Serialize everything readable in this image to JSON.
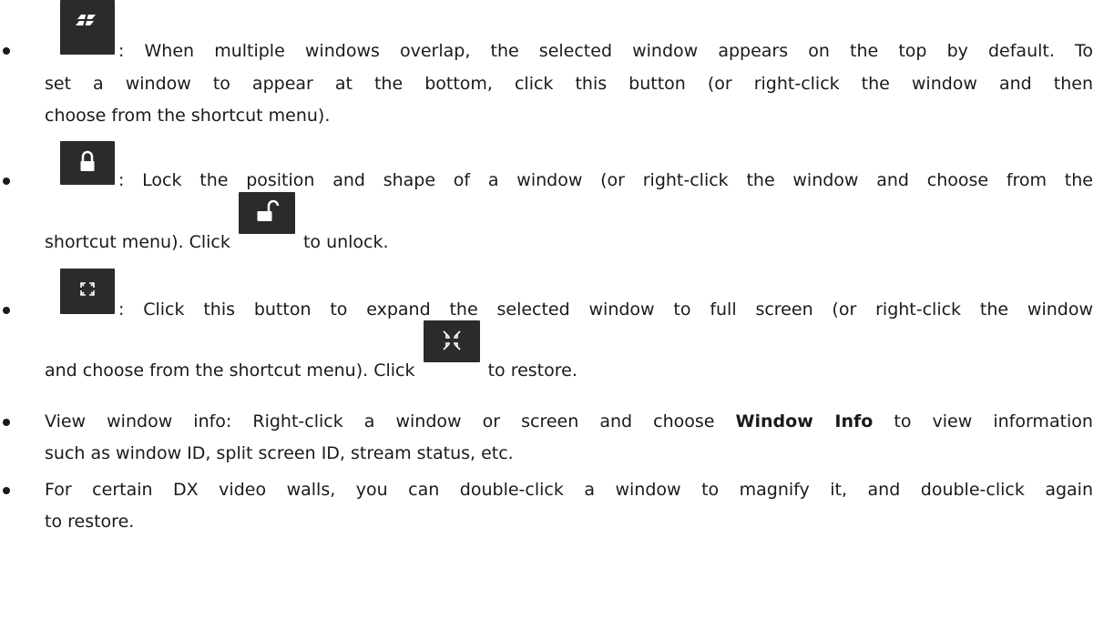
{
  "items": [
    {
      "icon": "layers-bottom-icon",
      "lines": [
        ": When multiple windows overlap, the selected window appears on the top by default. To",
        "set a window to appear at the bottom, click this button (or right-click the window and then",
        "choose from the shortcut menu)."
      ]
    },
    {
      "icon": "lock-icon",
      "line1": ": Lock the position and shape of a window (or right-click the window and choose from the",
      "line2_pre": "shortcut menu). Click",
      "line2_icon": "unlock-icon",
      "line2_post": "to unlock."
    },
    {
      "icon": "fullscreen-icon",
      "line1": ": Click this button to expand the selected window to full screen (or right-click the window",
      "line2_pre": "and choose from the shortcut menu). Click",
      "line2_icon": "exit-fullscreen-icon",
      "line2_post": "to restore."
    },
    {
      "line1_pre": "View window info: Right-click a window or screen and choose",
      "line1_bold": "Window Info",
      "line1_post": "to view information",
      "line2": "such as window ID, split screen ID, stream status, etc."
    },
    {
      "line1": "For certain DX video walls, you can double-click a window to magnify it, and double-click again",
      "line2": "to restore."
    }
  ]
}
